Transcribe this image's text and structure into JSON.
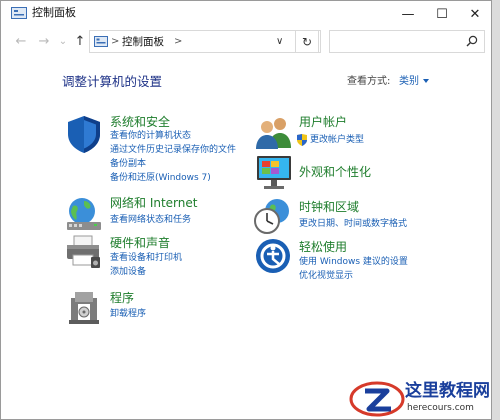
{
  "window": {
    "title": "控制面板"
  },
  "titlebar": {
    "minimize_glyph": "—",
    "maximize_glyph": "☐",
    "close_glyph": "✕"
  },
  "nav": {
    "back_glyph": "←",
    "forward_glyph": "→",
    "dropdown_glyph": "⌄",
    "up_glyph": "↑",
    "refresh_glyph": "↻"
  },
  "address": {
    "path": "控制面板",
    "separator": ">",
    "dropdown_glyph": "∨"
  },
  "main": {
    "title": "调整计算机的设置",
    "view_by_label": "查看方式:",
    "view_by_value": "类别"
  },
  "categories": [
    {
      "title": "系统和安全",
      "icon": "shield-icon",
      "links": [
        "查看你的计算机状态",
        "通过文件历史记录保存你的文件",
        "备份副本",
        "备份和还原(Windows 7)"
      ]
    },
    {
      "title": "网络和 Internet",
      "icon": "network-globe-icon",
      "links": [
        "查看网络状态和任务"
      ]
    },
    {
      "title": "硬件和声音",
      "icon": "printer-icon",
      "links": [
        "查看设备和打印机",
        "添加设备"
      ]
    },
    {
      "title": "程序",
      "icon": "programs-icon",
      "links": [
        "卸载程序"
      ]
    },
    {
      "title": "用户帐户",
      "icon": "users-icon",
      "links": [
        "更改帐户类型"
      ]
    },
    {
      "title": "外观和个性化",
      "icon": "monitor-icon",
      "links": []
    },
    {
      "title": "时钟和区域",
      "icon": "clock-globe-icon",
      "links": [
        "更改日期、时间或数字格式"
      ]
    },
    {
      "title": "轻松使用",
      "icon": "ease-of-access-icon",
      "links": [
        "使用 Windows 建议的设置",
        "优化视觉显示"
      ]
    }
  ],
  "watermark": {
    "name": "这里教程网",
    "url": "herecours.com"
  },
  "colors": {
    "category_title": "#1e7d2c",
    "link": "#1a5fb4",
    "page_title": "#1e3287"
  }
}
